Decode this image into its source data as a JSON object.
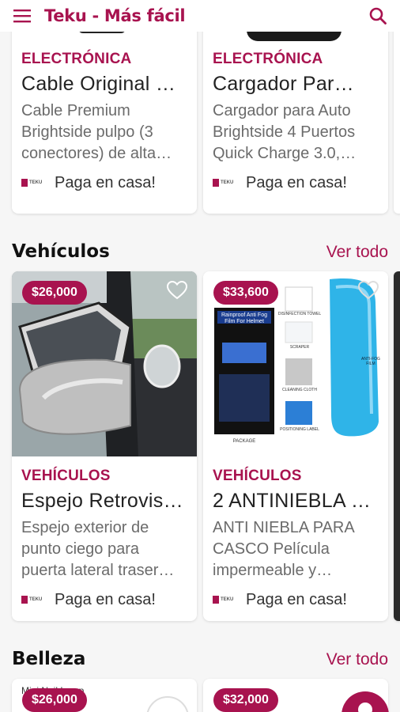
{
  "app": {
    "title": "Teku - Más fácil"
  },
  "top_cards": [
    {
      "category": "ELECTRÓNICA",
      "name": "Cable Original …",
      "desc": [
        "Cable Premium",
        "Brightside pulpo (3",
        "conectores) de alta…"
      ],
      "pay": "Paga en casa!"
    },
    {
      "category": "ELECTRÓNICA",
      "name": "Cargador Par…",
      "desc": [
        "Cargador para Auto",
        "Brightside 4 Puertos",
        "Quick Charge 3.0,…"
      ],
      "pay": "Paga en casa!"
    }
  ],
  "vehiculos": {
    "title": "Vehículos",
    "see_all": "Ver todo",
    "cards": [
      {
        "price": "$26,000",
        "category": "VEHÍCULOS",
        "name": "Espejo Retrovis…",
        "desc": [
          "Espejo exterior de",
          "punto ciego para",
          "puerta lateral traser…"
        ],
        "pay": "Paga en casa!"
      },
      {
        "price": "$33,600",
        "category": "VEHÍCULOS",
        "name": "2 ANTINIEBLA P…",
        "desc": [
          "ANTI NIEBLA PARA",
          "CASCO Película",
          "impermeable y…"
        ],
        "pay": "Paga en casa!"
      }
    ]
  },
  "belleza": {
    "title": "Belleza",
    "see_all": "Ver todo",
    "cards": [
      {
        "price": "$26,000",
        "img_text": "Mini Nail Lamp"
      },
      {
        "price": "$32,000"
      }
    ]
  },
  "brand_mini": "TEKU",
  "product_image_texts": {
    "film_box_title": "Rainproof Anti Fog Film For Helmet",
    "disinfection": "DISINFECTION TOWEL",
    "scraper": "SCRAPER",
    "cleaning": "CLEANING CLOTH",
    "positioning": "POSITIONING LABEL",
    "package": "PACKAGE",
    "film": "ANTI-FOG FILM"
  },
  "colors": {
    "brand": "#a8134f",
    "background": "#f6f6f6"
  }
}
